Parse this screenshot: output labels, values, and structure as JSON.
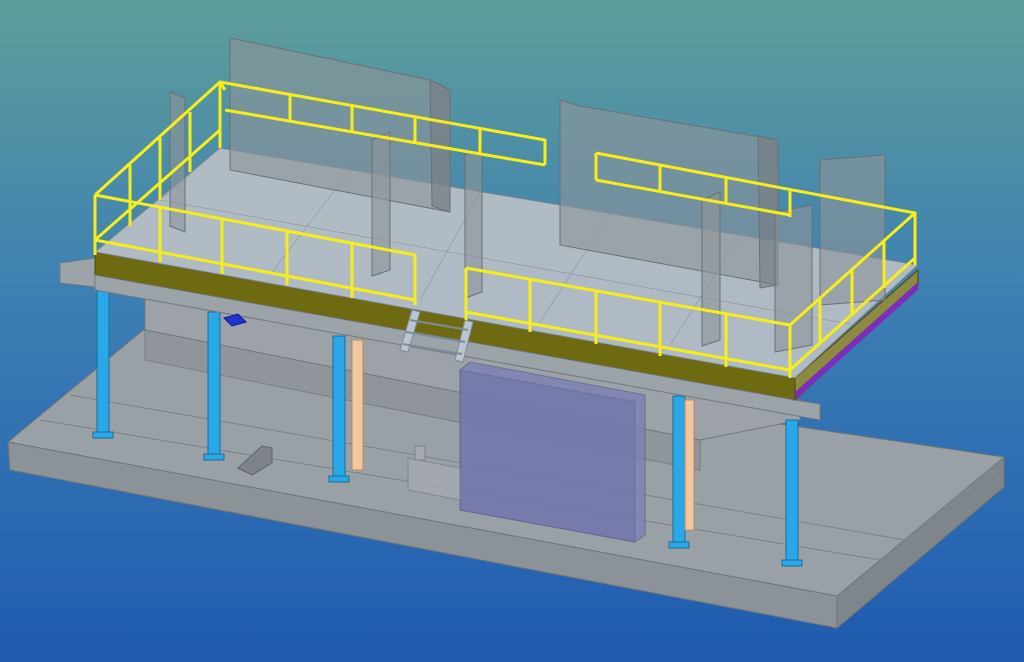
{
  "viewport": {
    "background_top": "#5e9e9a",
    "background_bottom": "#1f5ab0"
  },
  "colors": {
    "handrail": "#f5ee1a",
    "deck_edge": "#6e6a12",
    "column": "#2aa7e6",
    "timber_post": "#f0c7a1",
    "foundation": "#9aa0a6",
    "equipment_box": "#7a7fb5",
    "edge_trim": "#7b2fb8"
  },
  "icons": [
    "stair-icon",
    "handrail-icon"
  ]
}
